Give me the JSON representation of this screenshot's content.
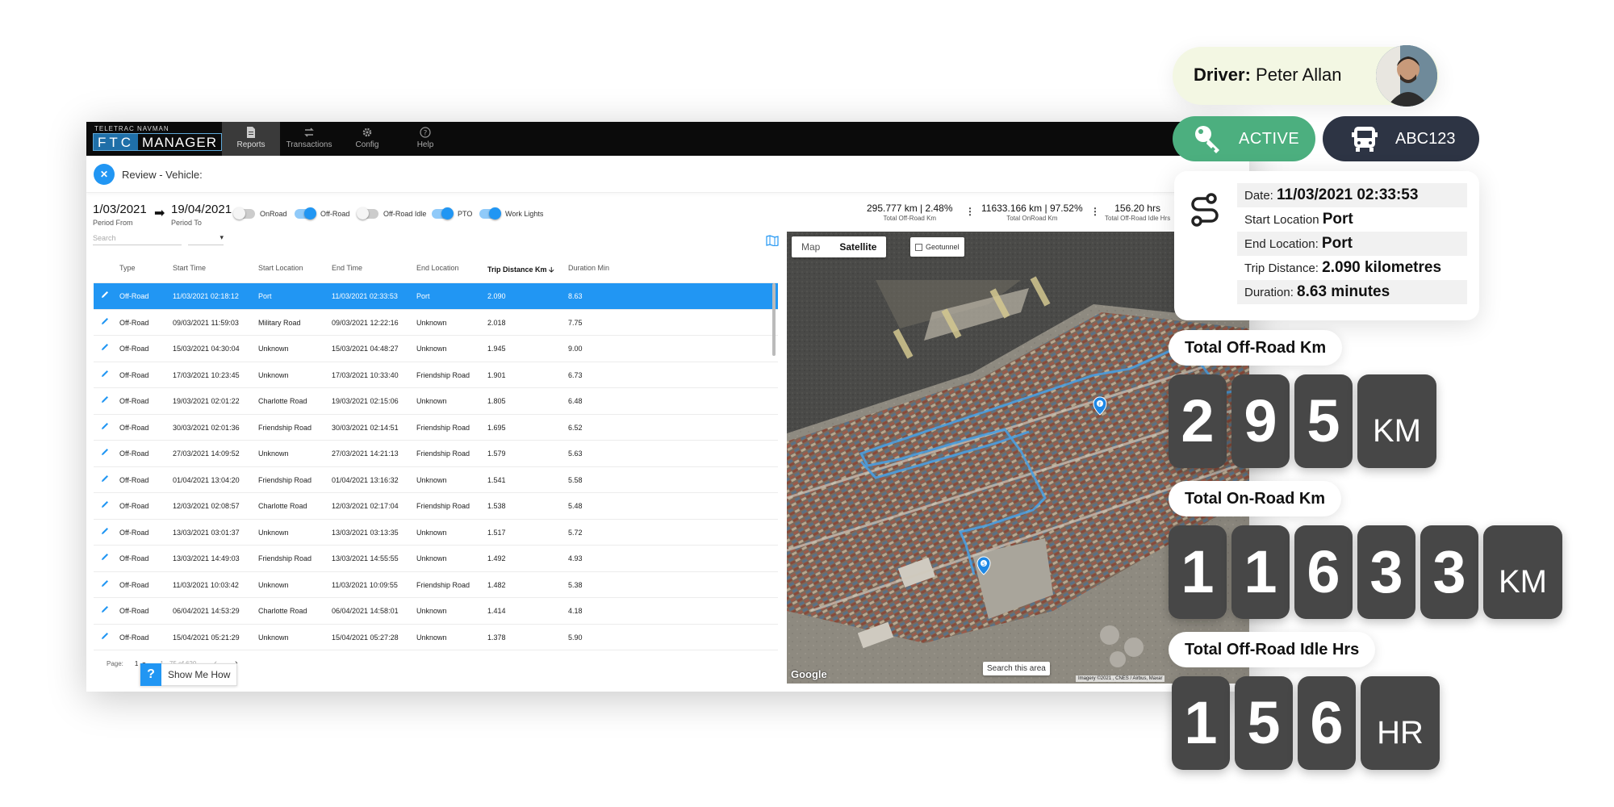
{
  "app": {
    "brand_top": "TELETRAC NAVMAN",
    "brand_ftc": "FTC",
    "brand_manager": "MANAGER",
    "nav": [
      {
        "label": "Reports",
        "icon": "file-icon"
      },
      {
        "label": "Transactions",
        "icon": "exchange-icon"
      },
      {
        "label": "Config",
        "icon": "gear-icon"
      },
      {
        "label": "Help",
        "icon": "help-icon"
      }
    ],
    "review_title": "Review - Vehicle:"
  },
  "period": {
    "from": "1/03/2021",
    "from_label": "Period From",
    "to": "19/04/2021",
    "to_label": "Period To"
  },
  "toggles": [
    {
      "label": "OnRoad",
      "on": false
    },
    {
      "label": "Off-Road",
      "on": true
    },
    {
      "label": "Off-Road Idle",
      "on": false
    },
    {
      "label": "PTO",
      "on": true
    },
    {
      "label": "Work Lights",
      "on": true
    }
  ],
  "stats": [
    {
      "value": "295.777 km | 2.48%",
      "label": "Total Off-Road Km"
    },
    {
      "value": "11633.166 km | 97.52%",
      "label": "Total OnRoad Km"
    },
    {
      "value": "156.20 hrs",
      "label": "Total Off-Road Idle Hrs"
    }
  ],
  "search": {
    "placeholder": "Search"
  },
  "table": {
    "columns": [
      "Type",
      "Start Time",
      "Start Location",
      "End Time",
      "End Location",
      "Trip Distance Km",
      "Duration Min"
    ],
    "rows": [
      [
        "Off-Road",
        "11/03/2021 02:18:12",
        "Port",
        "11/03/2021 02:33:53",
        "Port",
        "2.090",
        "8.63"
      ],
      [
        "Off-Road",
        "09/03/2021 11:59:03",
        "Military Road",
        "09/03/2021 12:22:16",
        "Unknown",
        "2.018",
        "7.75"
      ],
      [
        "Off-Road",
        "15/03/2021 04:30:04",
        "Unknown",
        "15/03/2021 04:48:27",
        "Unknown",
        "1.945",
        "9.00"
      ],
      [
        "Off-Road",
        "17/03/2021 10:23:45",
        "Unknown",
        "17/03/2021 10:33:40",
        "Friendship Road",
        "1.901",
        "6.73"
      ],
      [
        "Off-Road",
        "19/03/2021 02:01:22",
        "Charlotte Road",
        "19/03/2021 02:15:06",
        "Unknown",
        "1.805",
        "6.48"
      ],
      [
        "Off-Road",
        "30/03/2021 02:01:36",
        "Friendship Road",
        "30/03/2021 02:14:51",
        "Friendship Road",
        "1.695",
        "6.52"
      ],
      [
        "Off-Road",
        "27/03/2021 14:09:52",
        "Unknown",
        "27/03/2021 14:21:13",
        "Friendship Road",
        "1.579",
        "5.63"
      ],
      [
        "Off-Road",
        "01/04/2021 13:04:20",
        "Friendship Road",
        "01/04/2021 13:16:32",
        "Unknown",
        "1.541",
        "5.58"
      ],
      [
        "Off-Road",
        "12/03/2021 02:08:57",
        "Charlotte Road",
        "12/03/2021 02:17:04",
        "Friendship Road",
        "1.538",
        "5.48"
      ],
      [
        "Off-Road",
        "13/03/2021 03:01:37",
        "Unknown",
        "13/03/2021 03:13:35",
        "Unknown",
        "1.517",
        "5.72"
      ],
      [
        "Off-Road",
        "13/03/2021 14:49:03",
        "Friendship Road",
        "13/03/2021 14:55:55",
        "Unknown",
        "1.492",
        "4.93"
      ],
      [
        "Off-Road",
        "11/03/2021 10:03:42",
        "Unknown",
        "11/03/2021 10:09:55",
        "Friendship Road",
        "1.482",
        "5.38"
      ],
      [
        "Off-Road",
        "06/04/2021 14:53:29",
        "Charlotte Road",
        "06/04/2021 14:58:01",
        "Unknown",
        "1.414",
        "4.18"
      ],
      [
        "Off-Road",
        "15/04/2021 05:21:29",
        "Unknown",
        "15/04/2021 05:27:28",
        "Unknown",
        "1.378",
        "5.90"
      ]
    ]
  },
  "pager": {
    "label": "Page:",
    "page": "1",
    "range": "1 - 75 of 620"
  },
  "help": {
    "icon": "?",
    "label": "Show Me How"
  },
  "map": {
    "tab_map": "Map",
    "tab_satellite": "Satellite",
    "geotunnel": "Geotunnel",
    "search_area": "Search this area",
    "google": "Google",
    "credit": "Imagery ©2021 , CNES / Airbus, Maxar"
  },
  "driver": {
    "label": "Driver:",
    "name": "Peter Allan"
  },
  "status": {
    "label": "ACTIVE",
    "icon": "key-icon",
    "color": "#4caf7f"
  },
  "vehicle": {
    "label": "ABC123",
    "icon": "bus-icon",
    "color": "#2d3444"
  },
  "trip": {
    "date_label": "Date:",
    "date_value": "11/03/2021 02:33:53",
    "start_label": "Start Location",
    "start_value": "Port",
    "end_label": "End Location:",
    "end_value": "Port",
    "distance_label": "Trip Distance:",
    "distance_value": "2.090 kilometres",
    "duration_label": "Duration:",
    "duration_value": "8.63 minutes"
  },
  "counters": [
    {
      "title": "Total Off-Road Km",
      "digits": [
        "2",
        "9",
        "5"
      ],
      "unit": "KM"
    },
    {
      "title": "Total On-Road Km",
      "digits": [
        "1",
        "1",
        "6",
        "3",
        "3"
      ],
      "unit": "KM"
    },
    {
      "title": "Total Off-Road Idle Hrs",
      "digits": [
        "1",
        "5",
        "6"
      ],
      "unit": "HR"
    }
  ],
  "colors": {
    "accent": "#2196f3",
    "topbar": "#0b0b0b",
    "digit_tile": "#474747"
  }
}
